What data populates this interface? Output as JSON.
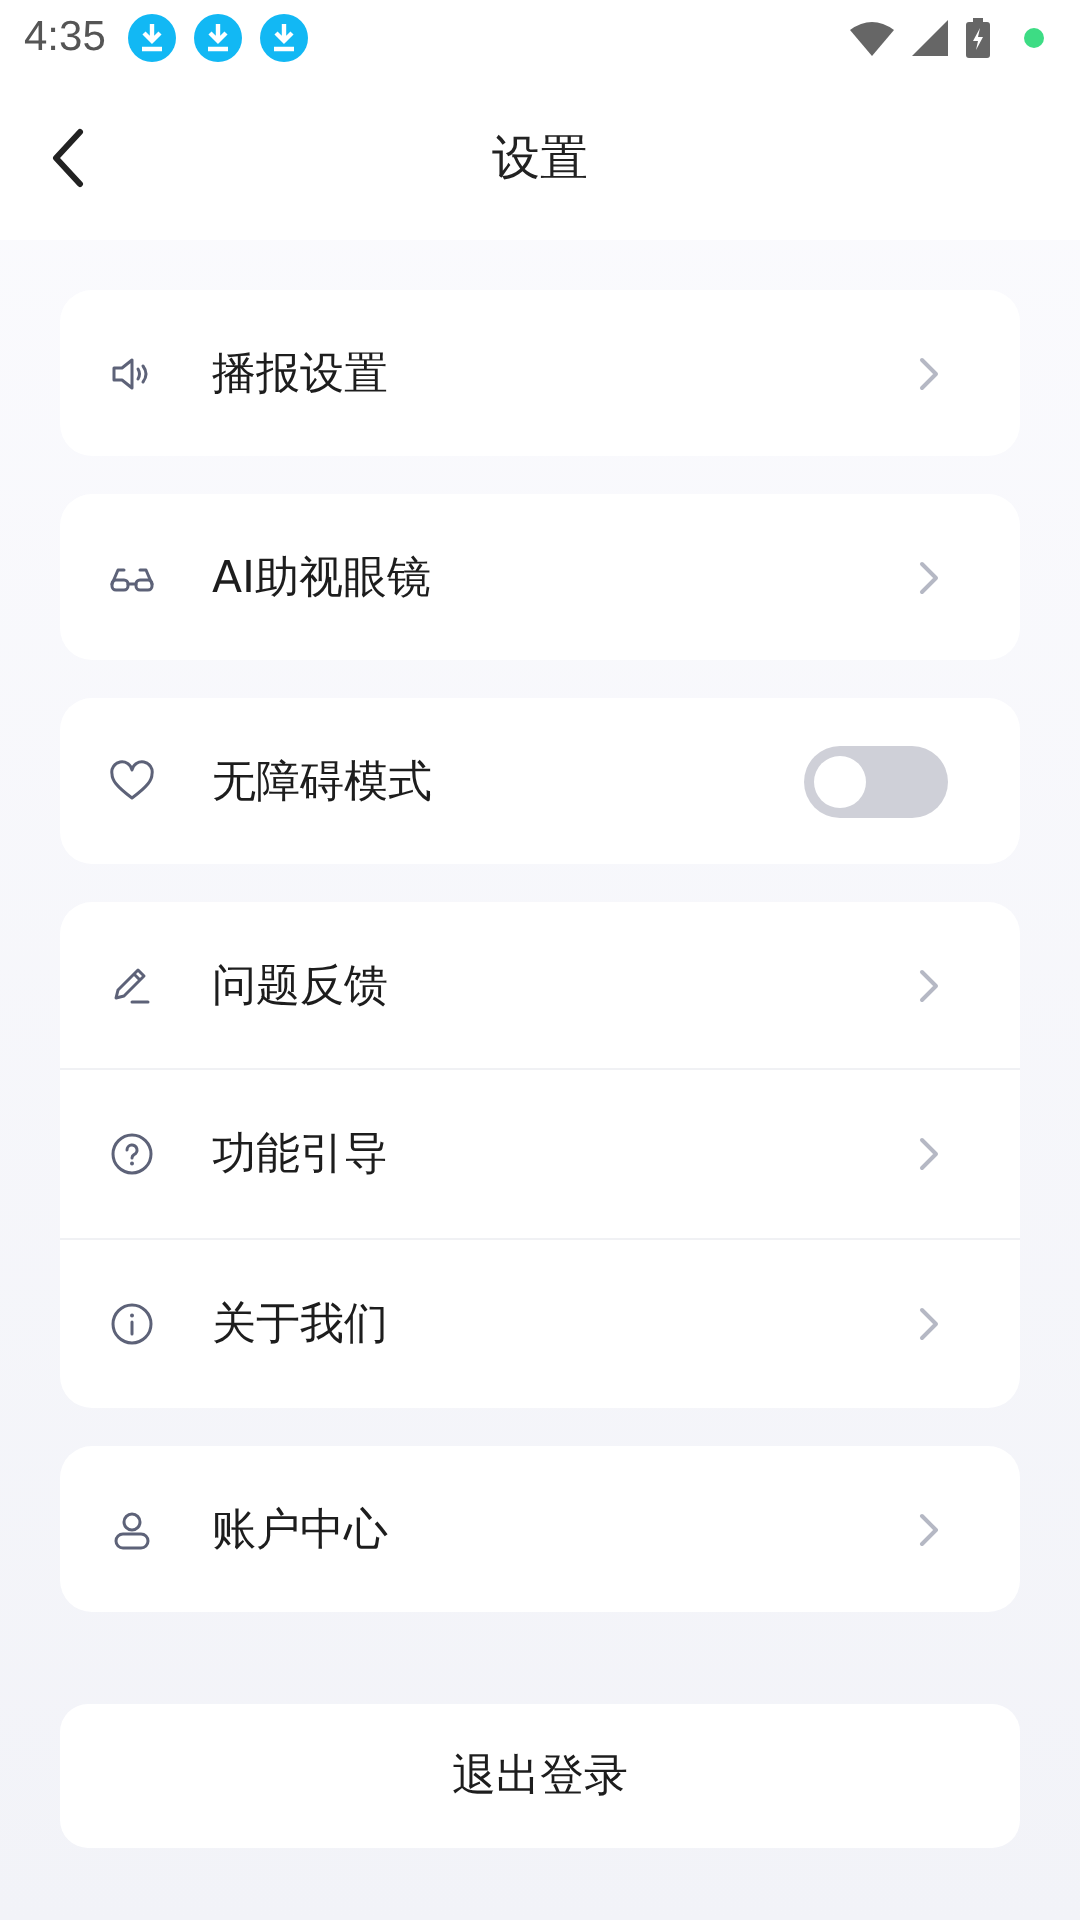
{
  "status_bar": {
    "time": "4:35"
  },
  "header": {
    "title": "设置"
  },
  "groups": [
    {
      "items": [
        {
          "kind": "link",
          "label": "播报设置"
        }
      ]
    },
    {
      "items": [
        {
          "kind": "link",
          "label": "AI助视眼镜"
        }
      ]
    },
    {
      "items": [
        {
          "kind": "toggle",
          "label": "无障碍模式",
          "on": false
        }
      ]
    },
    {
      "items": [
        {
          "kind": "link",
          "label": "问题反馈"
        },
        {
          "kind": "link",
          "label": "功能引导"
        },
        {
          "kind": "link",
          "label": "关于我们"
        }
      ]
    },
    {
      "items": [
        {
          "kind": "link",
          "label": "账户中心"
        }
      ]
    }
  ],
  "logout_button": "退出登录"
}
